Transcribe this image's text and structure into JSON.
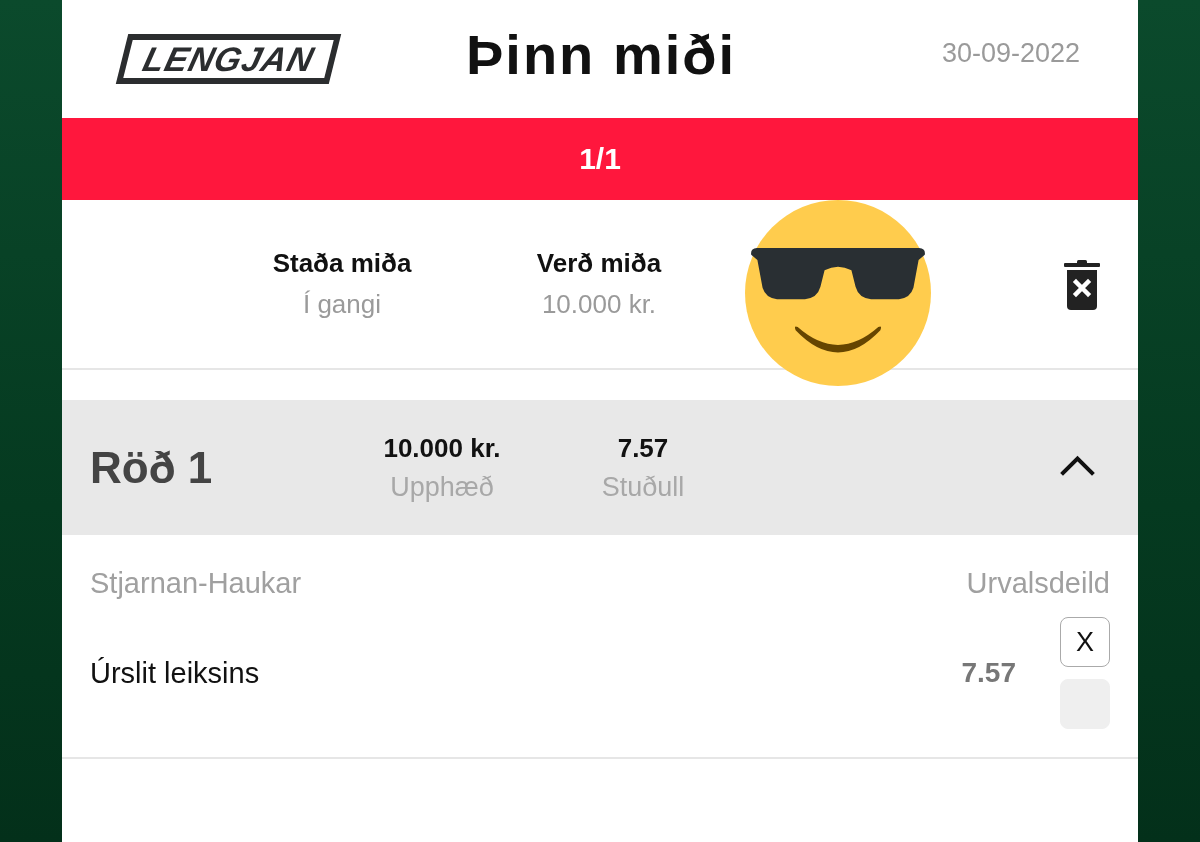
{
  "header": {
    "logo": "LENGJAN",
    "title": "Þinn miði",
    "date": "30-09-2022"
  },
  "pager": {
    "label": "1/1"
  },
  "ticket": {
    "stats": [
      {
        "label": "Staða miða",
        "value": "Í gangi"
      },
      {
        "label": "Verð miða",
        "value": "10.000 kr."
      }
    ]
  },
  "rows": [
    {
      "title": "Röð 1",
      "expanded": true,
      "stats": [
        {
          "value": "10.000 kr.",
          "label": "Upphæð"
        },
        {
          "value": "7.57",
          "label": "Stuðull"
        }
      ],
      "matches": [
        {
          "teams": "Stjarnan-Haukar",
          "league": "Urvalsdeild",
          "market": "Úrslit leiksins",
          "odds": "7.57",
          "picks": [
            {
              "label": "X",
              "selected": true
            },
            {
              "selected": false
            }
          ]
        }
      ]
    }
  ]
}
